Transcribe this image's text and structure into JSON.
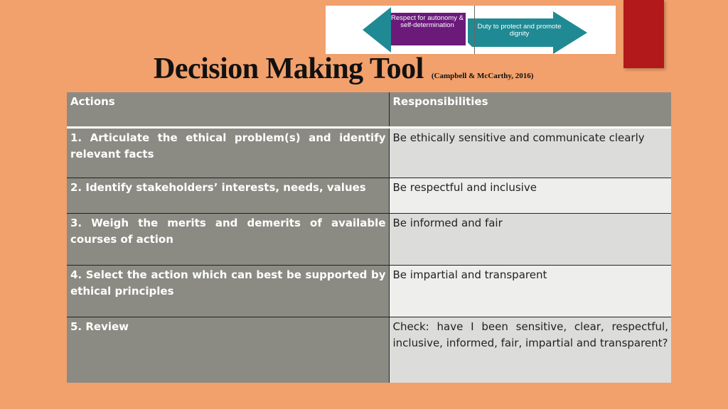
{
  "banner": {
    "left_arrow_text": "Respect for autonomy & self-determination",
    "right_arrow_text": "Duty to protect and promote dignity",
    "colors": {
      "teal": "#1f8a94",
      "purple": "#6b1a7a"
    }
  },
  "header": {
    "title": "Decision Making Tool",
    "citation": "(Campbell  & McCarthy, 2016)"
  },
  "table": {
    "columns": [
      "Actions",
      "Responsibilities"
    ],
    "rows": [
      {
        "action": "1. Articulate the ethical problem(s) and identify relevant facts",
        "responsibility": "Be ethically sensitive and communicate clearly"
      },
      {
        "action": "2. Identify stakeholders’ interests, needs, values",
        "responsibility": "Be respectful and inclusive"
      },
      {
        "action": "3. Weigh the merits and demerits of available courses of action",
        "responsibility": "Be informed and fair"
      },
      {
        "action": "4. Select the action which can best be supported by ethical principles",
        "responsibility": "Be impartial and transparent"
      },
      {
        "action": "5. Review",
        "responsibility": "Check: have I been sensitive, clear, respectful, inclusive, informed, fair, impartial and transparent?"
      }
    ]
  },
  "colors": {
    "background": "#f2a06c",
    "accent_red": "#b2191a",
    "header_gray": "#8b8b84"
  }
}
